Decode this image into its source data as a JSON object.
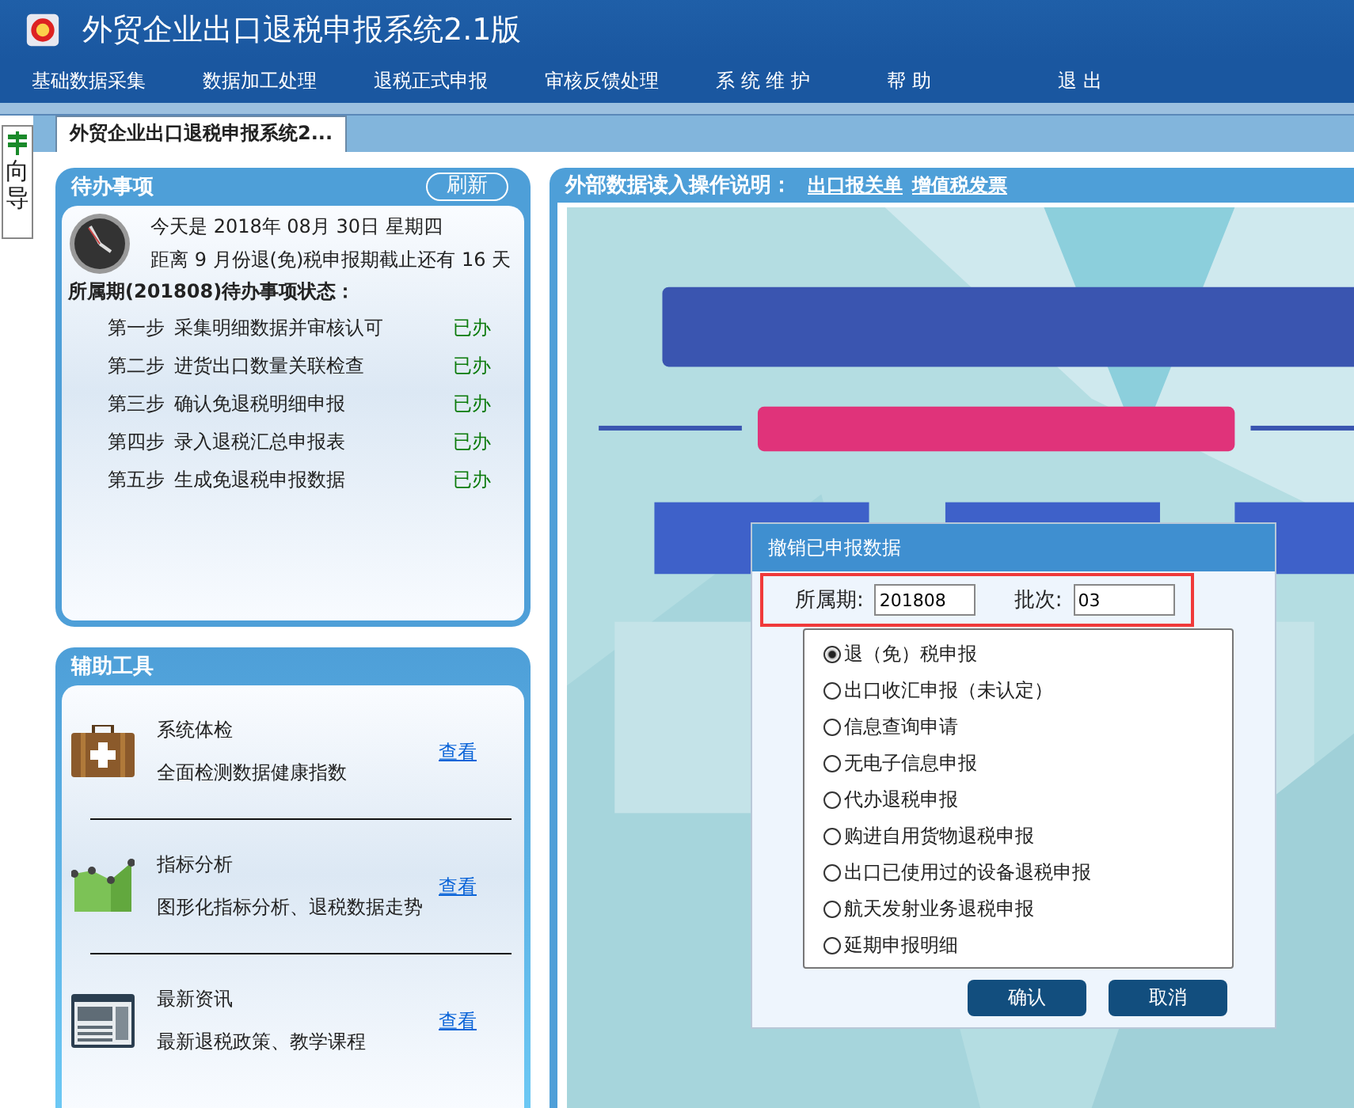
{
  "window": {
    "title": "外贸企业出口退税申报系统2.1版"
  },
  "menu": [
    "基础数据采集",
    "数据加工处理",
    "退税正式申报",
    "审核反馈处理",
    "系 统 维 护",
    "帮  助",
    "退  出"
  ],
  "side_tab": {
    "label": "向导"
  },
  "tabs": [
    {
      "label": "外贸企业出口退税申报系统2...",
      "selected": true
    }
  ],
  "todo": {
    "title": "待办事项",
    "refresh": "刷新",
    "date_line": "今天是 2018年 08月 30日 星期四",
    "deadline_line": "距离 9 月份退(免)税申报期截止还有 16 天",
    "status_title": "所属期(201808)待办事项状态：",
    "steps": [
      {
        "step": "第一步",
        "task": "采集明细数据并审核认可",
        "status": "已办"
      },
      {
        "step": "第二步",
        "task": "进货出口数量关联检查",
        "status": "已办"
      },
      {
        "step": "第三步",
        "task": "确认免退税明细申报",
        "status": "已办"
      },
      {
        "step": "第四步",
        "task": "录入退税汇总申报表",
        "status": "已办"
      },
      {
        "step": "第五步",
        "task": "生成免退税申报数据",
        "status": "已办"
      }
    ]
  },
  "tools": {
    "title": "辅助工具",
    "items": [
      {
        "kind": "kit",
        "name": "系统体检",
        "desc": "全面检测数据健康指数",
        "link": "查看"
      },
      {
        "kind": "chart",
        "name": "指标分析",
        "desc": "图形化指标分析、退税数据走势",
        "link": "查看"
      },
      {
        "kind": "news",
        "name": "最新资讯",
        "desc": "最新退税政策、教学课程",
        "link": "查看"
      }
    ]
  },
  "info": {
    "title": "外部数据读入操作说明：",
    "links": [
      "出口报关单",
      "增值税发票"
    ]
  },
  "dialog": {
    "title": "撤销已申报数据",
    "period_label": "所属期:",
    "period": "201808",
    "batch_label": "批次:",
    "batch": "03",
    "options": [
      {
        "label": "退（免）税申报",
        "selected": true
      },
      {
        "label": "出口收汇申报（未认定）",
        "selected": false
      },
      {
        "label": "信息查询申请",
        "selected": false
      },
      {
        "label": "无电子信息申报",
        "selected": false
      },
      {
        "label": "代办退税申报",
        "selected": false
      },
      {
        "label": "购进自用货物退税申报",
        "selected": false
      },
      {
        "label": "出口已使用过的设备退税申报",
        "selected": false
      },
      {
        "label": "航天发射业务退税申报",
        "selected": false
      },
      {
        "label": "延期申报明细",
        "selected": false
      }
    ],
    "buttons": [
      "确认",
      "取消"
    ]
  }
}
